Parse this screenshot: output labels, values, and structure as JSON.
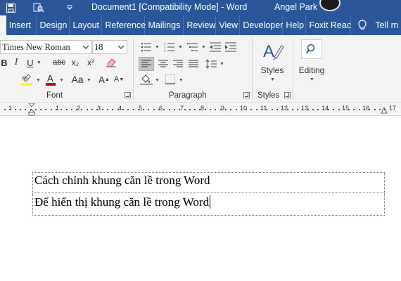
{
  "titlebar": {
    "doc_title": "Document1 [Compatibility Mode]  -  Word",
    "user_name": "Angel Park",
    "qat_icons": [
      "save-icon",
      "print-preview-icon",
      "customize-qat-icon"
    ]
  },
  "tabs": [
    "Insert",
    "Design",
    "Layout",
    "Reference",
    "Mailings",
    "Review",
    "View",
    "Developer",
    "Help",
    "Foxit Reac",
    "Tell m"
  ],
  "ribbon": {
    "font_name": "Times New Roman",
    "font_size": "18",
    "groups": {
      "font": "Font",
      "paragraph": "Paragraph",
      "styles": "Styles"
    },
    "styles_label": "Styles",
    "editing_label": "Editing",
    "strike_label": "abc",
    "subscript_label": "x₂",
    "superscript_label": "x²",
    "font_color": "#d00000",
    "highlight_color": "#ffff00"
  },
  "ruler": {
    "labels": [
      "1",
      "1",
      "2",
      "3",
      "4",
      "5",
      "6",
      "7",
      "8",
      "9",
      "10",
      "11",
      "12",
      "13",
      "14",
      "15",
      "16",
      "17"
    ]
  },
  "document": {
    "lines": [
      "Cách chỉnh khung căn lề trong Word",
      "Để hiển thị khung căn lề trong Word"
    ]
  },
  "colors": {
    "titlebar": "#2b579a",
    "ribbon": "#f3f3f3",
    "accent": "#2b579a"
  }
}
